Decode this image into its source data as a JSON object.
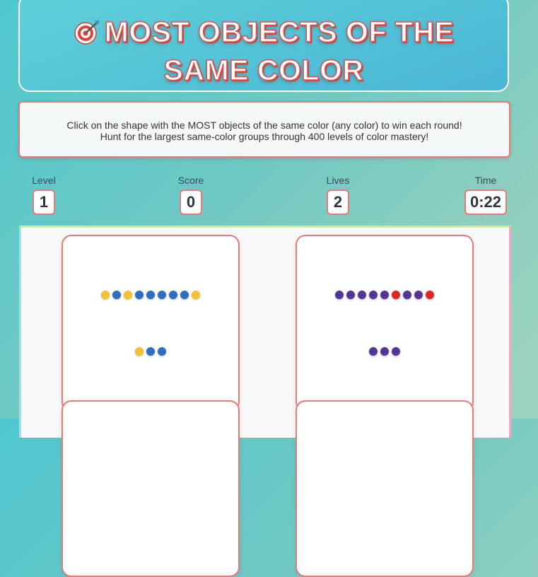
{
  "header": {
    "title_line1": "MOST OBJECTS OF THE",
    "title_line2": "SAME COLOR",
    "icon": "target-icon"
  },
  "instructions": {
    "line1": "Click on the shape with the MOST objects of the same color (any color) to win each round!",
    "line2": "Hunt for the largest same-color groups through 400 levels of color mastery!"
  },
  "stats": {
    "level": {
      "label": "Level",
      "value": "1"
    },
    "score": {
      "label": "Score",
      "value": "0"
    },
    "lives": {
      "label": "Lives",
      "value": "2"
    },
    "time": {
      "label": "Time",
      "value": "0:22"
    }
  },
  "colors": {
    "yellow": "#f3c232",
    "blue": "#2e6fc0",
    "purple": "#553399",
    "red": "#e02424",
    "accent": "#e87a76"
  },
  "cards": [
    {
      "rows": [
        [
          "yellow",
          "blue",
          "yellow",
          "blue",
          "blue",
          "blue",
          "blue",
          "blue",
          "yellow"
        ],
        [
          "yellow",
          "blue",
          "blue"
        ]
      ]
    },
    {
      "rows": [
        [
          "purple",
          "purple",
          "purple",
          "purple",
          "purple",
          "red",
          "purple",
          "purple",
          "red"
        ],
        [
          "purple",
          "purple",
          "purple"
        ]
      ]
    }
  ]
}
